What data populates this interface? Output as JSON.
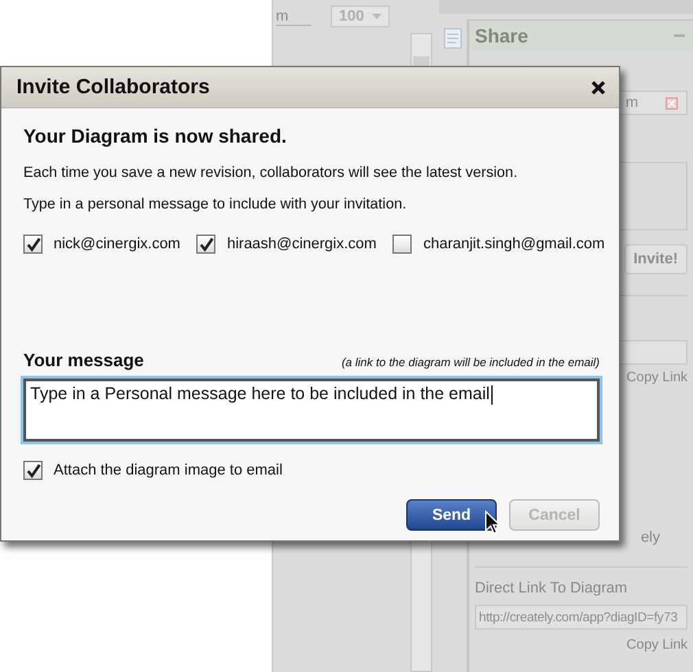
{
  "toolbar": {
    "zoom_label": "m",
    "zoom_value": "100"
  },
  "share_panel": {
    "title": "Share",
    "collaborator_field": "m",
    "invite_button": "Invite!",
    "copy_link_1": "Copy Link",
    "visibility_note": "ely",
    "direct_link_label": "Direct Link To Diagram",
    "direct_link": "http://creately.com/app?diagID=fy73",
    "copy_link_2": "Copy Link"
  },
  "dialog": {
    "title": "Invite Collaborators",
    "heading": "Your Diagram is now shared.",
    "lines": [
      "Each time you save a new revision, collaborators will see the latest version.",
      "Type in a personal message to include with your invitation."
    ],
    "recipients": [
      {
        "email": "nick@cinergix.com",
        "checked": true
      },
      {
        "email": "hiraash@cinergix.com",
        "checked": true
      },
      {
        "email": "charanjit.singh@gmail.com",
        "checked": false
      }
    ],
    "message": {
      "label": "Your message",
      "note": "(a link to the diagram will be included in the email)",
      "value": "Type in a Personal message here to be included in the email"
    },
    "attach": {
      "label": "Attach the diagram image to email",
      "checked": true
    },
    "buttons": [
      {
        "label": "Send",
        "kind": "primary",
        "disabled": false
      },
      {
        "label": "Cancel",
        "kind": "default",
        "disabled": true
      }
    ]
  }
}
